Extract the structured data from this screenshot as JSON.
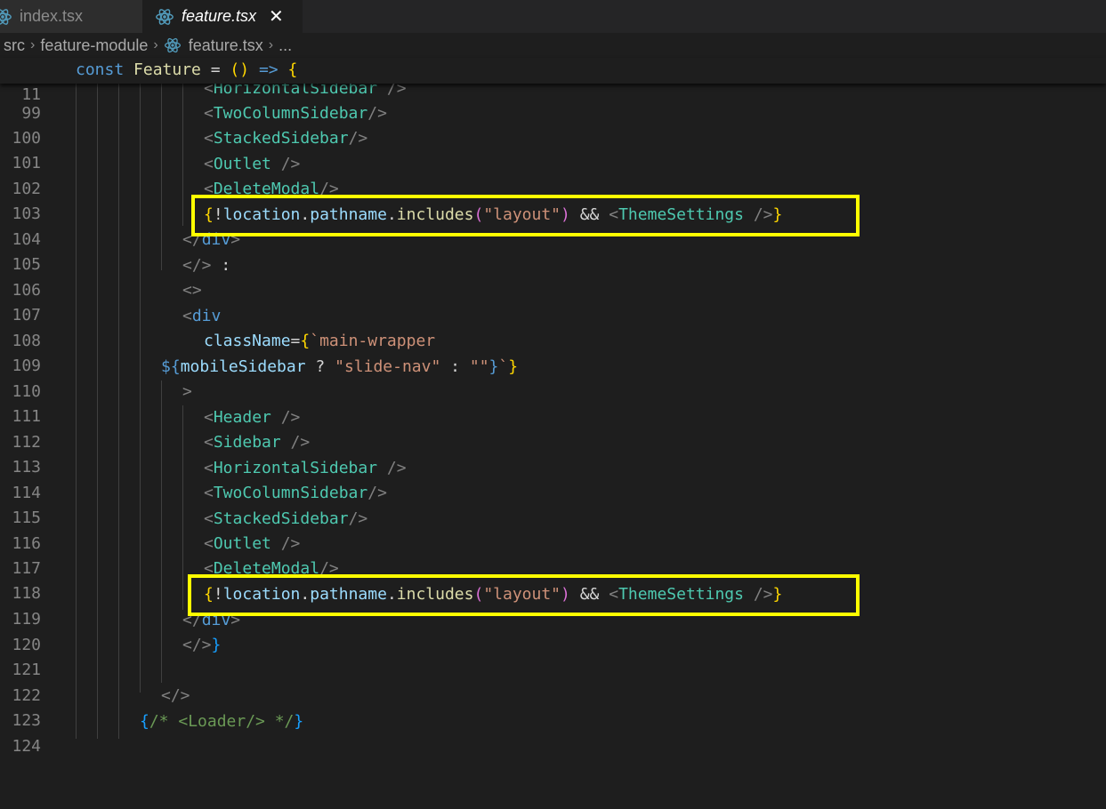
{
  "tabs": [
    {
      "label": "index.tsx",
      "active": false
    },
    {
      "label": "feature.tsx",
      "active": true,
      "close_glyph": "✕"
    }
  ],
  "breadcrumb": {
    "segments": [
      "src",
      "feature-module",
      "feature.tsx",
      "..."
    ]
  },
  "sticky_line": {
    "number": "11",
    "code": "const Feature = () => {"
  },
  "line_numbers": [
    "99",
    "100",
    "101",
    "102",
    "103",
    "104",
    "105",
    "106",
    "107",
    "108",
    "109",
    "110",
    "111",
    "112",
    "113",
    "114",
    "115",
    "116",
    "117",
    "118",
    "119",
    "120",
    "121",
    "122",
    "123",
    "124"
  ],
  "code": {
    "l99": "<HorizontalSidebar />",
    "l100": "<TwoColumnSidebar/>",
    "l101": "<StackedSidebar/>",
    "l102": "<Outlet />",
    "l103": "<DeleteModal/>",
    "l104": "{!location.pathname.includes(\"layout\") && <ThemeSettings />}",
    "l105": "</div>",
    "l106": "</> :",
    "l107": "<>",
    "l108": "<div",
    "l109": "className={`main-wrapper",
    "l110": "${mobileSidebar ? \"slide-nav\" : \"\"}`}",
    "l111": ">",
    "l112": "<Header />",
    "l113": "<Sidebar />",
    "l114": "<HorizontalSidebar />",
    "l115": "<TwoColumnSidebar/>",
    "l116": "<StackedSidebar/>",
    "l117": "<Outlet />",
    "l118": "<DeleteModal/>",
    "l119": "{!location.pathname.includes(\"layout\") && <ThemeSettings />}",
    "l120": "</div>",
    "l121": "</>}",
    "l123": "</>",
    "l124": "{/* <Loader/> */}"
  },
  "icons": {
    "tab_file_icon": "react-icon",
    "close_icon": "close-icon",
    "chevron": "chevron-right-icon"
  },
  "colors": {
    "editor_bg": "#1e1e1e",
    "highlight_box": "#ffff00",
    "react_icon": "#519aba"
  }
}
